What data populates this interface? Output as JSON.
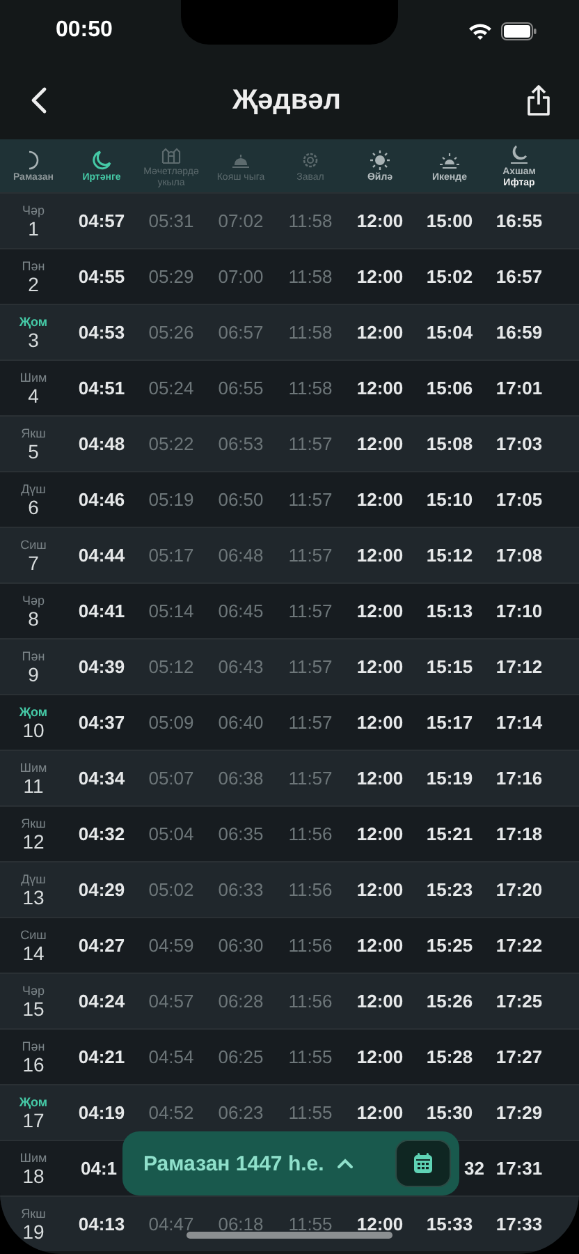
{
  "status_bar": {
    "time": "00:50"
  },
  "nav": {
    "title": "Җәдвәл"
  },
  "columns": [
    {
      "label": "Рамазан",
      "kind": "day",
      "selected": false
    },
    {
      "label": "Иртәнге",
      "kind": "main",
      "selected": true
    },
    {
      "label": "Мәчетләрдә укыла",
      "kind": "dim",
      "selected": false
    },
    {
      "label": "Кояш чыга",
      "kind": "dim",
      "selected": false
    },
    {
      "label": "Завал",
      "kind": "dim",
      "selected": false
    },
    {
      "label": "Өйлә",
      "kind": "main",
      "selected": false
    },
    {
      "label": "Икенде",
      "kind": "main",
      "selected": false
    },
    {
      "label": "Ахшам",
      "sublabel": "Ифтар",
      "kind": "main",
      "selected": false
    }
  ],
  "rows": [
    {
      "weekday": "Чәр",
      "day": "1",
      "highlighted": false,
      "times": [
        "04:57",
        "05:31",
        "07:02",
        "11:58",
        "12:00",
        "15:00",
        "16:55"
      ]
    },
    {
      "weekday": "Пән",
      "day": "2",
      "highlighted": false,
      "times": [
        "04:55",
        "05:29",
        "07:00",
        "11:58",
        "12:00",
        "15:02",
        "16:57"
      ]
    },
    {
      "weekday": "Җом",
      "day": "3",
      "highlighted": true,
      "times": [
        "04:53",
        "05:26",
        "06:57",
        "11:58",
        "12:00",
        "15:04",
        "16:59"
      ]
    },
    {
      "weekday": "Шим",
      "day": "4",
      "highlighted": false,
      "times": [
        "04:51",
        "05:24",
        "06:55",
        "11:58",
        "12:00",
        "15:06",
        "17:01"
      ]
    },
    {
      "weekday": "Якш",
      "day": "5",
      "highlighted": false,
      "times": [
        "04:48",
        "05:22",
        "06:53",
        "11:57",
        "12:00",
        "15:08",
        "17:03"
      ]
    },
    {
      "weekday": "Дүш",
      "day": "6",
      "highlighted": false,
      "times": [
        "04:46",
        "05:19",
        "06:50",
        "11:57",
        "12:00",
        "15:10",
        "17:05"
      ]
    },
    {
      "weekday": "Сиш",
      "day": "7",
      "highlighted": false,
      "times": [
        "04:44",
        "05:17",
        "06:48",
        "11:57",
        "12:00",
        "15:12",
        "17:08"
      ]
    },
    {
      "weekday": "Чәр",
      "day": "8",
      "highlighted": false,
      "times": [
        "04:41",
        "05:14",
        "06:45",
        "11:57",
        "12:00",
        "15:13",
        "17:10"
      ]
    },
    {
      "weekday": "Пән",
      "day": "9",
      "highlighted": false,
      "times": [
        "04:39",
        "05:12",
        "06:43",
        "11:57",
        "12:00",
        "15:15",
        "17:12"
      ]
    },
    {
      "weekday": "Җом",
      "day": "10",
      "highlighted": true,
      "times": [
        "04:37",
        "05:09",
        "06:40",
        "11:57",
        "12:00",
        "15:17",
        "17:14"
      ]
    },
    {
      "weekday": "Шим",
      "day": "11",
      "highlighted": false,
      "times": [
        "04:34",
        "05:07",
        "06:38",
        "11:57",
        "12:00",
        "15:19",
        "17:16"
      ]
    },
    {
      "weekday": "Якш",
      "day": "12",
      "highlighted": false,
      "times": [
        "04:32",
        "05:04",
        "06:35",
        "11:56",
        "12:00",
        "15:21",
        "17:18"
      ]
    },
    {
      "weekday": "Дүш",
      "day": "13",
      "highlighted": false,
      "times": [
        "04:29",
        "05:02",
        "06:33",
        "11:56",
        "12:00",
        "15:23",
        "17:20"
      ]
    },
    {
      "weekday": "Сиш",
      "day": "14",
      "highlighted": false,
      "times": [
        "04:27",
        "04:59",
        "06:30",
        "11:56",
        "12:00",
        "15:25",
        "17:22"
      ]
    },
    {
      "weekday": "Чәр",
      "day": "15",
      "highlighted": false,
      "times": [
        "04:24",
        "04:57",
        "06:28",
        "11:56",
        "12:00",
        "15:26",
        "17:25"
      ]
    },
    {
      "weekday": "Пән",
      "day": "16",
      "highlighted": false,
      "times": [
        "04:21",
        "04:54",
        "06:25",
        "11:55",
        "12:00",
        "15:28",
        "17:27"
      ]
    },
    {
      "weekday": "Җом",
      "day": "17",
      "highlighted": true,
      "times": [
        "04:19",
        "04:52",
        "06:23",
        "11:55",
        "12:00",
        "15:30",
        "17:29"
      ]
    },
    {
      "weekday": "Шим",
      "day": "18",
      "highlighted": false,
      "kind": "covered",
      "times": [
        "04:1",
        "32",
        "17:31"
      ]
    },
    {
      "weekday": "Якш",
      "day": "19",
      "highlighted": false,
      "times": [
        "04:13",
        "04:47",
        "06:18",
        "11:55",
        "12:00",
        "15:33",
        "17:33"
      ]
    }
  ],
  "month_picker": {
    "label": "Рамазан 1447 һ.е.",
    "expanded": false
  }
}
